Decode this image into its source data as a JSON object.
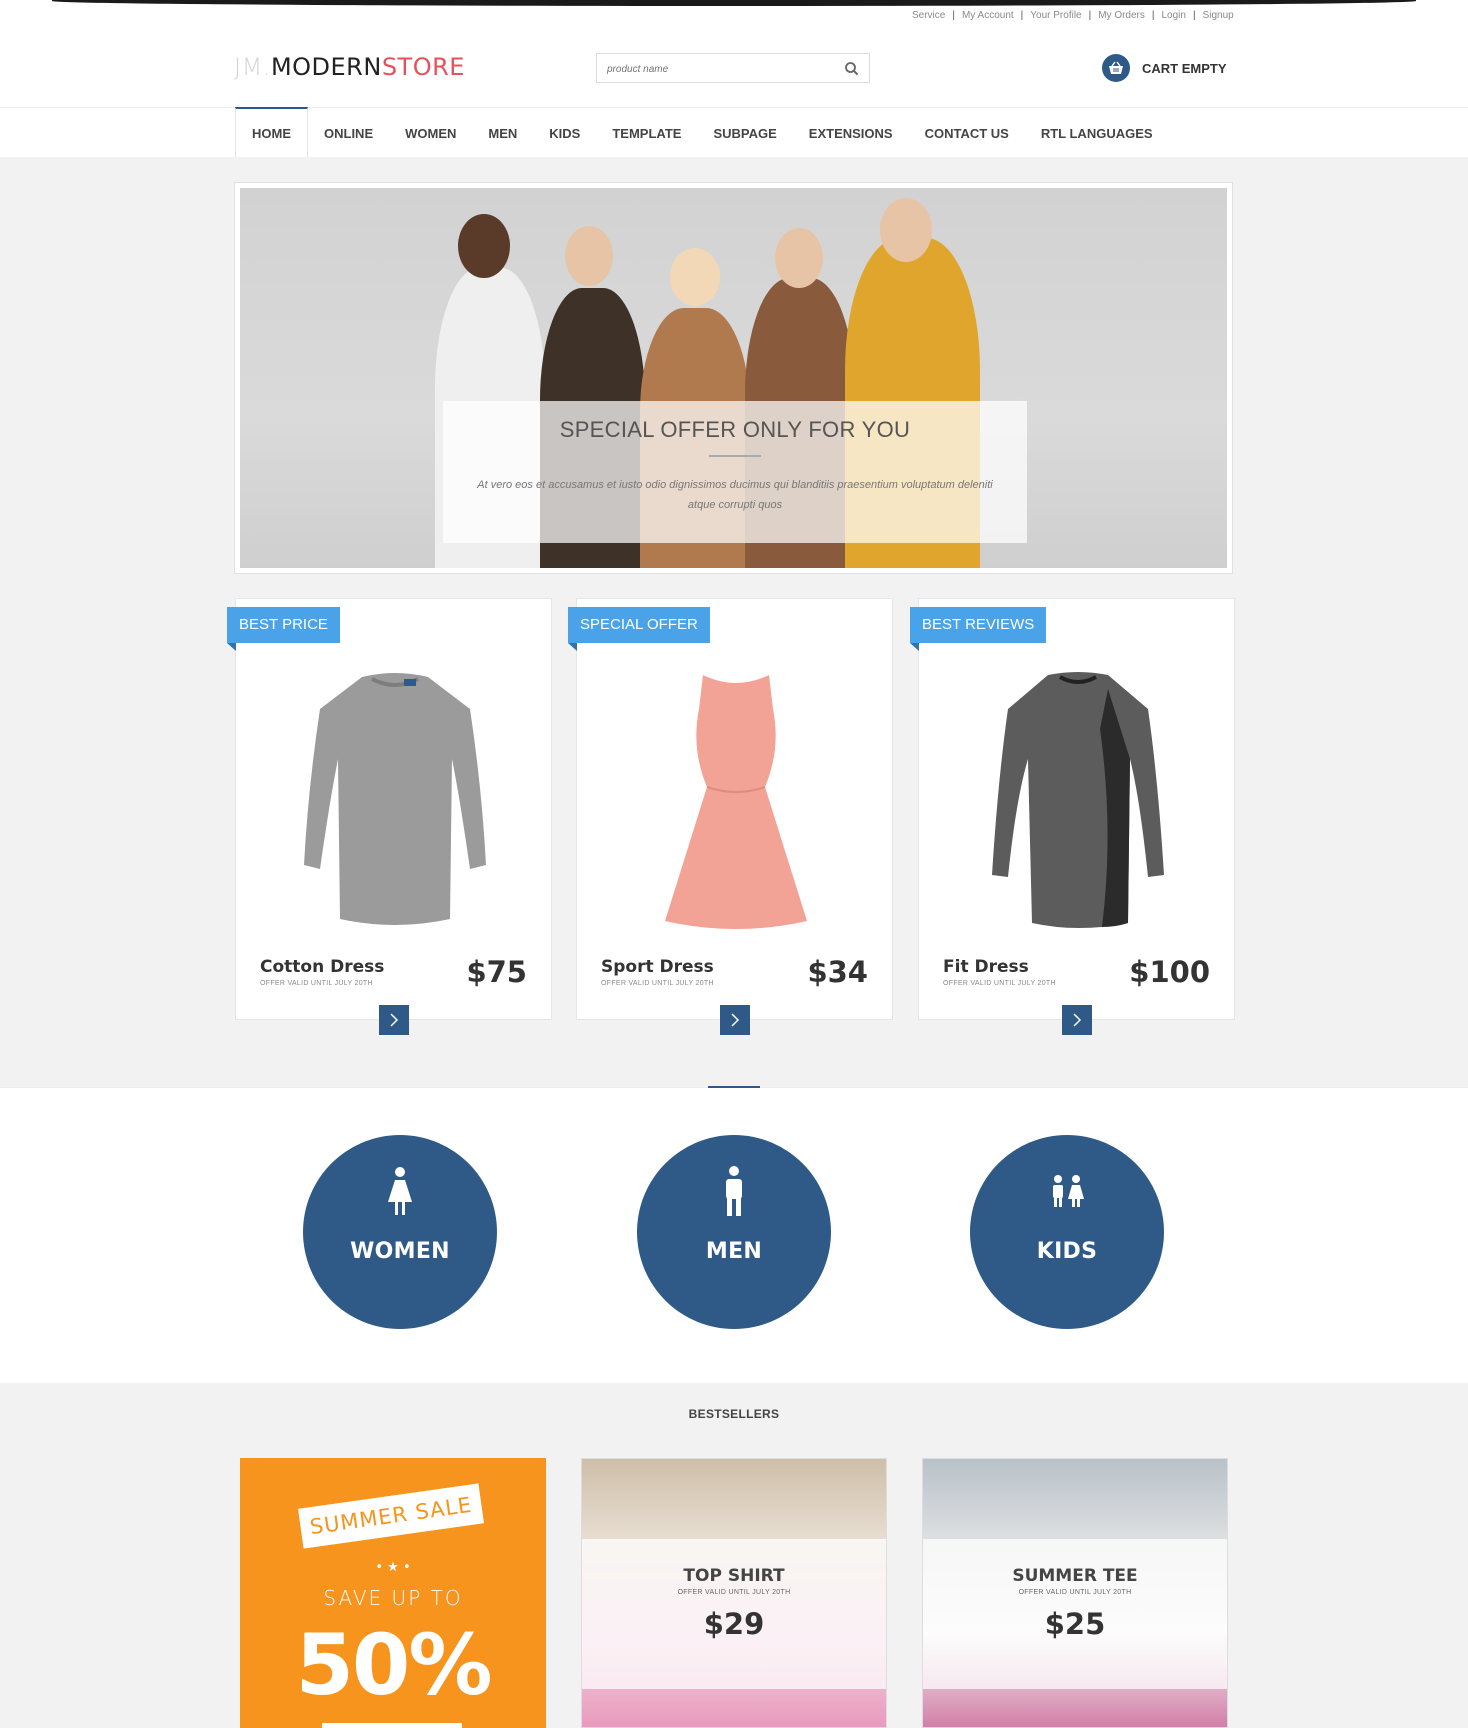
{
  "top_links": [
    "Service",
    "My Account",
    "Your Profile",
    "My Orders",
    "Login",
    "Signup"
  ],
  "logo": {
    "prefix": "JM",
    "part1": "MODERN",
    "part2": "STORE"
  },
  "search": {
    "placeholder": "product name",
    "icon": "search-icon"
  },
  "cart": {
    "label": "CART EMPTY",
    "icon": "basket-icon"
  },
  "nav": {
    "items": [
      "HOME",
      "ONLINE",
      "WOMEN",
      "MEN",
      "KIDS",
      "TEMPLATE",
      "SUBPAGE",
      "EXTENSIONS",
      "CONTACT US",
      "RTL LANGUAGES"
    ],
    "active": "HOME"
  },
  "hero": {
    "title": "SPECIAL OFFER ONLY FOR YOU",
    "text": "At vero eos et accusamus et iusto odio dignissimos ducimus qui blanditiis praesentium voluptatum deleniti atque corrupti quos"
  },
  "products": [
    {
      "badge": "BEST PRICE",
      "name": "Cotton Dress",
      "sub": "OFFER VALID UNTIL JULY 20TH",
      "price": "$75"
    },
    {
      "badge": "SPECIAL OFFER",
      "name": "Sport Dress",
      "sub": "OFFER VALID UNTIL JULY 20TH",
      "price": "$34"
    },
    {
      "badge": "BEST REVIEWS",
      "name": "Fit Dress",
      "sub": "OFFER VALID UNTIL JULY 20TH",
      "price": "$100"
    }
  ],
  "categories": [
    {
      "label": "WOMEN",
      "icon": "woman-icon"
    },
    {
      "label": "MEN",
      "icon": "man-icon"
    },
    {
      "label": "KIDS",
      "icon": "kids-icon"
    }
  ],
  "bestsellers": {
    "title": "BESTSELLERS",
    "sale": {
      "banner": "SUMMER SALE",
      "stars": "• ★ •",
      "save": "SAVE UP TO",
      "percent": "50%"
    },
    "items": [
      {
        "name": "TOP SHIRT",
        "sub": "OFFER VALID UNTIL JULY 20TH",
        "price": "$29"
      },
      {
        "name": "SUMMER TEE",
        "sub": "OFFER VALID UNTIL JULY 20TH",
        "price": "$25"
      }
    ]
  },
  "colors": {
    "accent": "#2f5a87",
    "ribbon": "#4aa3e8",
    "logo_store": "#e8515b",
    "sale": "#f7941d"
  }
}
